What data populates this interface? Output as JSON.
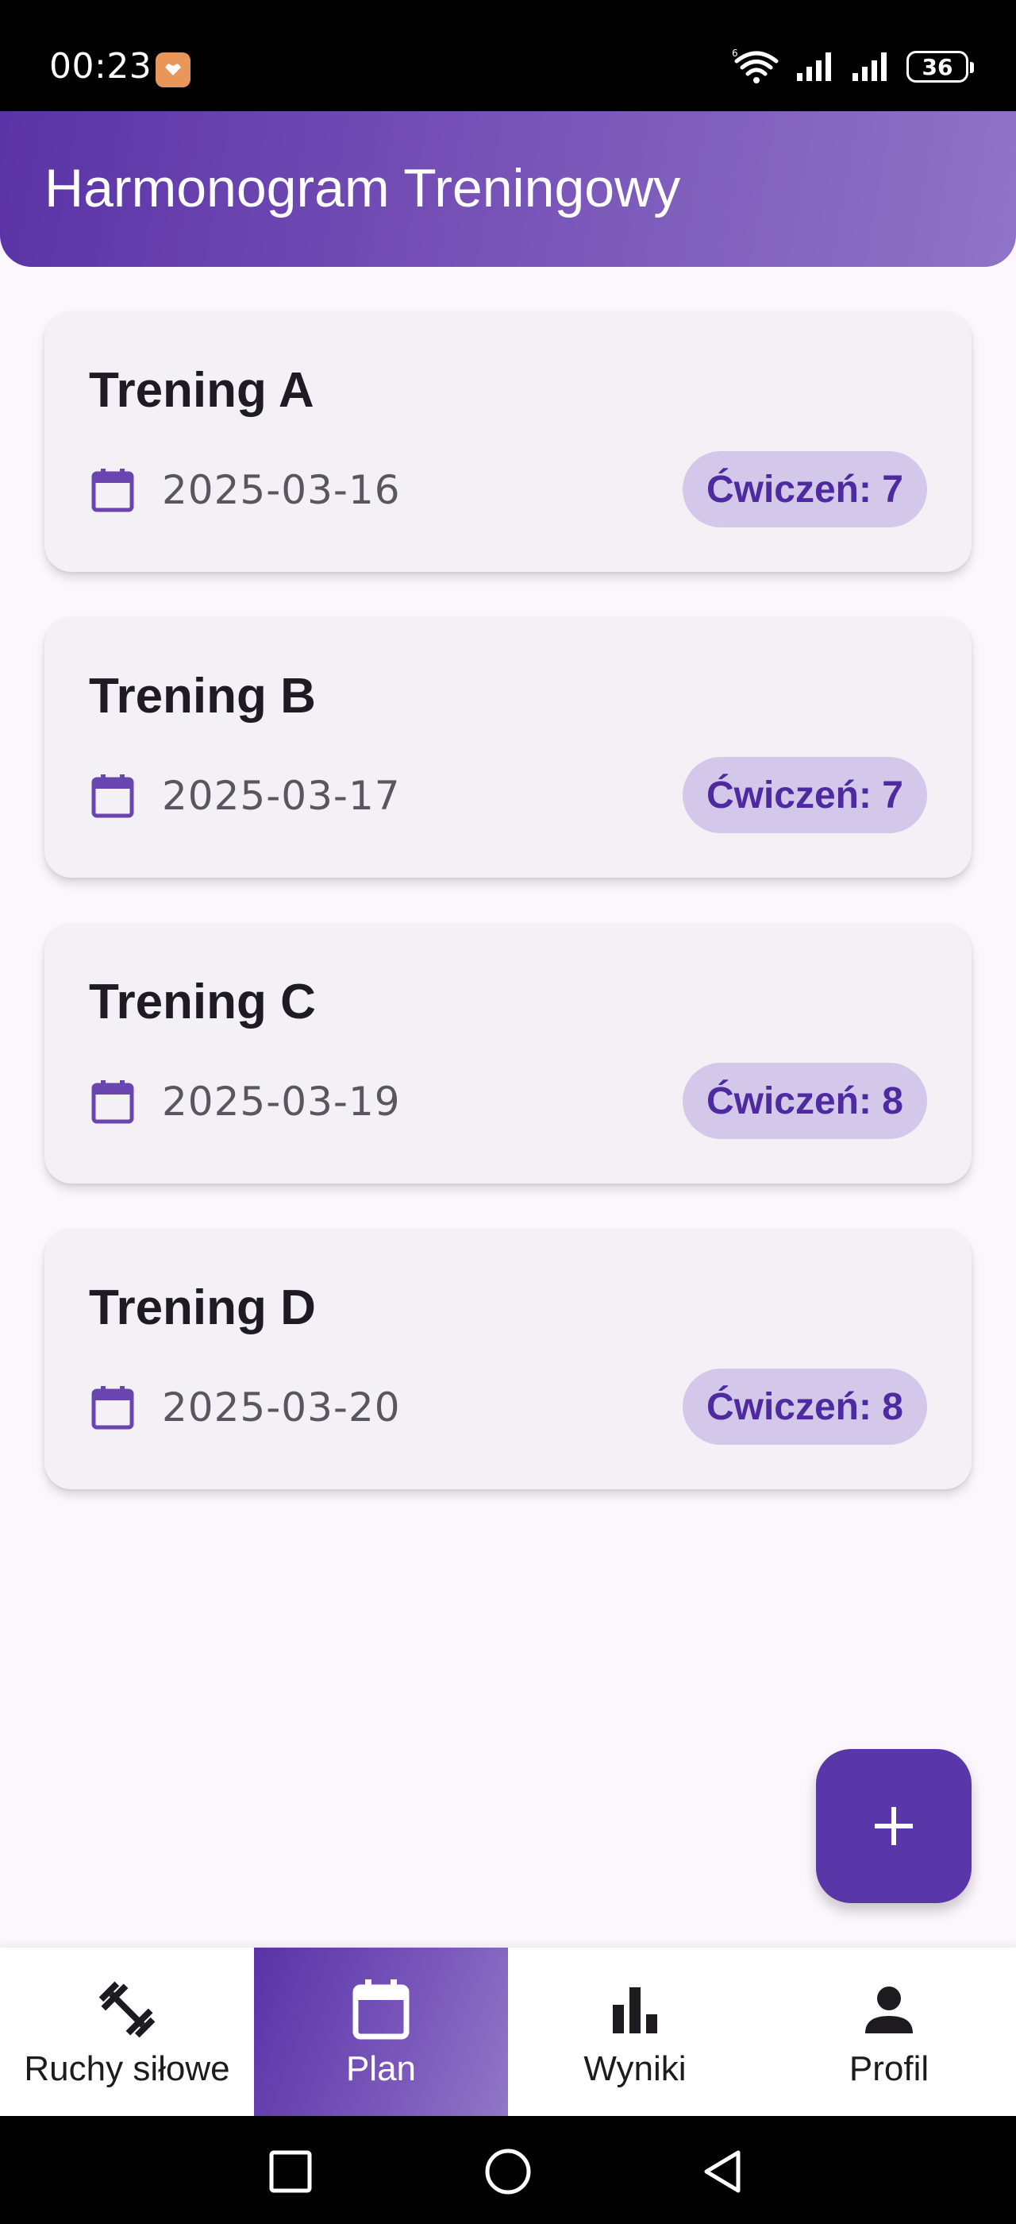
{
  "status_bar": {
    "time": "00:23",
    "app_icon": "heart-app-icon",
    "icons": [
      "wifi-6-icon",
      "signal-icon",
      "signal-icon"
    ],
    "battery": "36"
  },
  "header": {
    "title": "Harmonogram Treningowy"
  },
  "workouts": [
    {
      "name": "Trening A",
      "date": "2025-03-16",
      "exercises": "Ćwiczeń: 7"
    },
    {
      "name": "Trening B",
      "date": "2025-03-17",
      "exercises": "Ćwiczeń: 7"
    },
    {
      "name": "Trening C",
      "date": "2025-03-19",
      "exercises": "Ćwiczeń: 8"
    },
    {
      "name": "Trening D",
      "date": "2025-03-20",
      "exercises": "Ćwiczeń: 8"
    }
  ],
  "fab": {
    "icon": "plus-icon"
  },
  "bottom_nav": {
    "items": [
      {
        "label": "Ruchy siłowe",
        "icon": "dumbbell-icon",
        "active": false
      },
      {
        "label": "Plan",
        "icon": "calendar-icon",
        "active": true
      },
      {
        "label": "Wyniki",
        "icon": "bar-chart-icon",
        "active": false
      },
      {
        "label": "Profil",
        "icon": "person-icon",
        "active": false
      }
    ]
  },
  "colors": {
    "primary": "#5a37a8",
    "badge_bg": "#d3c8ea",
    "badge_text": "#4d2aa0",
    "card_bg": "#f3f1f6",
    "page_bg": "#fcf7fd"
  }
}
